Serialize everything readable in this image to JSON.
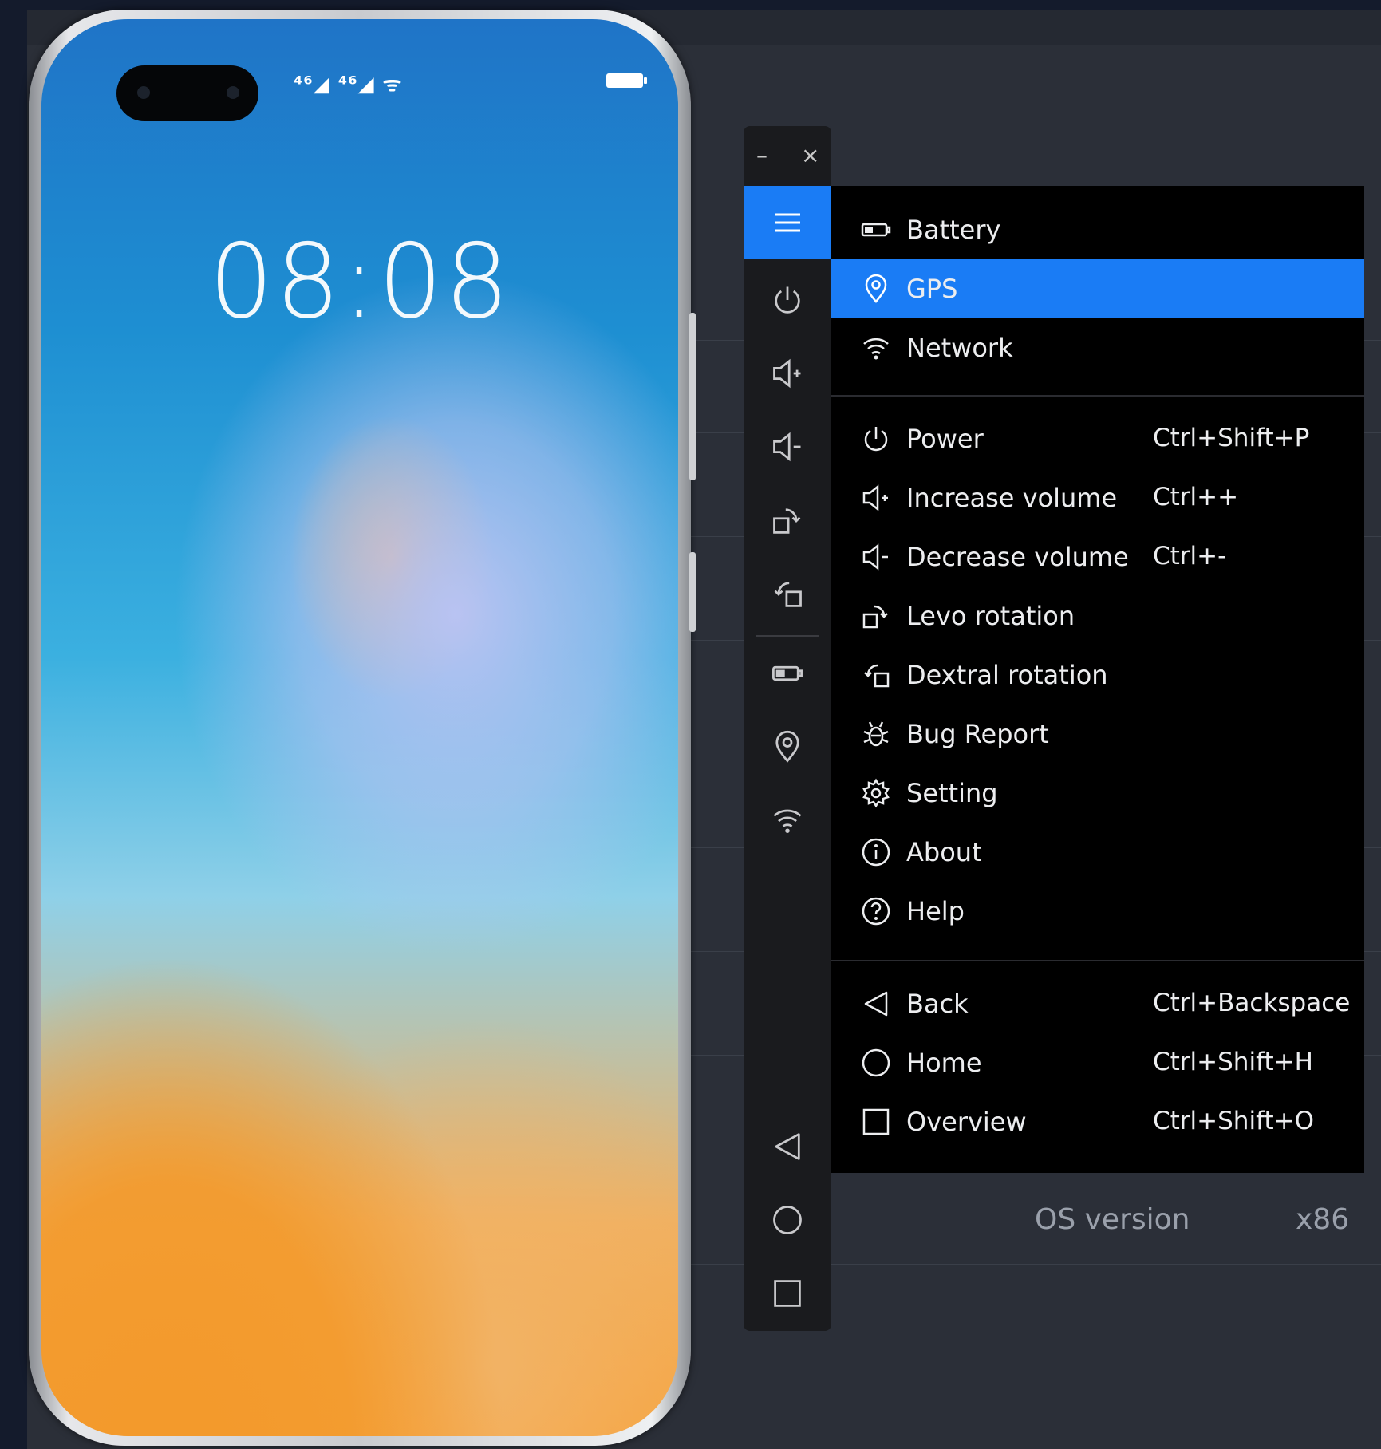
{
  "phone": {
    "clock": "08:08",
    "status_signal": "⁴⁶◢ ⁴⁶◢ ᯤ"
  },
  "background": {
    "info_label": "OS version",
    "info_value": "x86"
  },
  "toolbar": {
    "minimize": "–",
    "close": "×"
  },
  "menu": {
    "group1": [
      {
        "label": "Battery",
        "icon": "battery-icon"
      },
      {
        "label": "GPS",
        "icon": "location-pin-icon",
        "active": true
      },
      {
        "label": "Network",
        "icon": "wifi-icon"
      }
    ],
    "group2": [
      {
        "label": "Power",
        "shortcut": "Ctrl+Shift+P",
        "icon": "power-icon"
      },
      {
        "label": "Increase volume",
        "shortcut": "Ctrl++",
        "icon": "volume-up-icon"
      },
      {
        "label": "Decrease volume",
        "shortcut": "Ctrl+-",
        "icon": "volume-down-icon"
      },
      {
        "label": "Levo rotation",
        "shortcut": "",
        "icon": "rotate-left-icon"
      },
      {
        "label": "Dextral rotation",
        "shortcut": "",
        "icon": "rotate-right-icon"
      },
      {
        "label": "Bug Report",
        "shortcut": "",
        "icon": "bug-icon"
      },
      {
        "label": "Setting",
        "shortcut": "",
        "icon": "gear-icon"
      },
      {
        "label": "About",
        "shortcut": "",
        "icon": "info-icon"
      },
      {
        "label": "Help",
        "shortcut": "",
        "icon": "help-icon"
      }
    ],
    "group3": [
      {
        "label": "Back",
        "shortcut": "Ctrl+Backspace",
        "icon": "back-triangle-icon"
      },
      {
        "label": "Home",
        "shortcut": "Ctrl+Shift+H",
        "icon": "home-circle-icon"
      },
      {
        "label": "Overview",
        "shortcut": "Ctrl+Shift+O",
        "icon": "overview-square-icon"
      }
    ]
  },
  "colors": {
    "accent": "#1a7cf5",
    "menu_bg": "#000000",
    "toolbar_bg": "#1a1b1e",
    "page_bg": "#141b2c"
  }
}
